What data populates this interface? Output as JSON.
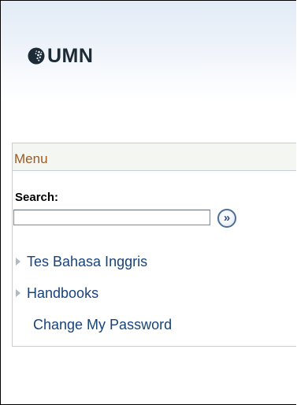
{
  "header": {
    "logo_text": "UMN"
  },
  "menu": {
    "title": "Menu",
    "search_label": "Search:",
    "search_value": "",
    "search_placeholder": "",
    "go_button_icon": "double-chevron-right-icon",
    "items": [
      {
        "label": "Tes Bahasa Inggris",
        "expandable": true
      },
      {
        "label": "Handbooks",
        "expandable": true
      },
      {
        "label": "Change My Password",
        "expandable": false
      }
    ]
  }
}
